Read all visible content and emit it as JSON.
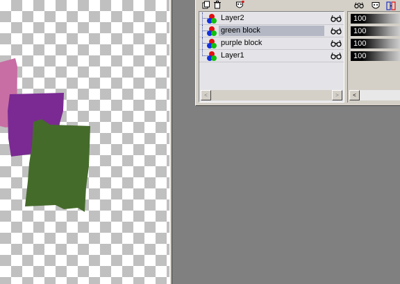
{
  "canvas": {
    "background": "transparent-checkerboard",
    "shapes": [
      {
        "name": "pink block",
        "color": "#c86ea4"
      },
      {
        "name": "purple block",
        "color": "#7a2a92"
      },
      {
        "name": "green block",
        "color": "#456b2b"
      }
    ]
  },
  "layers_palette": {
    "toolbar_icons": [
      "new-layer-icon",
      "delete-layer-icon",
      "mask-icon"
    ],
    "right_toolbar_icons": [
      "glasses-icon",
      "mask-icon",
      "link-icon"
    ],
    "layers": [
      {
        "name": "Layer2",
        "selected": false,
        "visible": true,
        "opacity": "100"
      },
      {
        "name": "green block",
        "selected": true,
        "visible": true,
        "opacity": "100"
      },
      {
        "name": "purple block",
        "selected": false,
        "visible": true,
        "opacity": "100"
      },
      {
        "name": "Layer1",
        "selected": false,
        "visible": true,
        "opacity": "100"
      }
    ],
    "scroll_left_arrow": "<",
    "scroll_right_arrow": ">",
    "colors": {
      "selected_row": "#b4b8c4",
      "list_background": "#e4e4e8",
      "workspace": "#808080"
    }
  }
}
